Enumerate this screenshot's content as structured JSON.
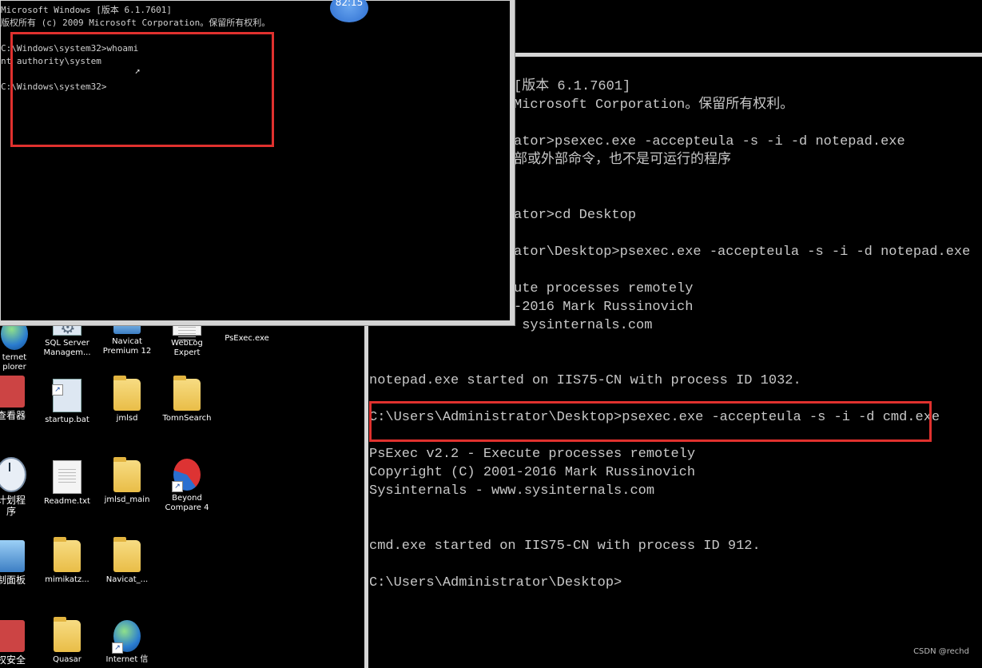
{
  "desktop": {
    "icons": [
      {
        "label": "ternet\nplorer",
        "icon": "internet-explorer-icon"
      },
      {
        "label": "SQL Server\nManagem...",
        "icon": "sql-server-icon"
      },
      {
        "label": "Navicat\nPremium 12",
        "icon": "navicat-icon"
      },
      {
        "label": "WebLog\nExpert",
        "icon": "weblog-icon"
      },
      {
        "label": "PsExec.exe",
        "icon": "exe-icon"
      },
      {
        "label": "查看器",
        "icon": "viewer-icon"
      },
      {
        "label": "startup.bat",
        "icon": "bat-file-icon"
      },
      {
        "label": "jmlsd",
        "icon": "folder-icon"
      },
      {
        "label": "TomnSearch",
        "icon": "folder-icon"
      },
      {
        "label": "计划程\n序",
        "icon": "task-scheduler-icon"
      },
      {
        "label": "Readme.txt",
        "icon": "text-file-icon"
      },
      {
        "label": "jmlsd_main",
        "icon": "folder-icon"
      },
      {
        "label": "Beyond\nCompare 4",
        "icon": "beyond-compare-icon"
      },
      {
        "label": "制面板",
        "icon": "control-panel-icon"
      },
      {
        "label": "mimikatz...",
        "icon": "folder-icon"
      },
      {
        "label": "Navicat_...",
        "icon": "folder-icon"
      },
      {
        "label": "权安全",
        "icon": "firewall-icon"
      },
      {
        "label": "Quasar",
        "icon": "folder-icon"
      },
      {
        "label": "Internet 信",
        "icon": "iis-manager-icon"
      }
    ]
  },
  "cmd_left": {
    "clock": "82:15",
    "lines": [
      "Microsoft Windows [版本 6.1.7601]",
      "版权所有 (c) 2009 Microsoft Corporation。保留所有权利。",
      "",
      "C:\\Windows\\system32>whoami",
      "nt authority\\system",
      "",
      "C:\\Windows\\system32>"
    ]
  },
  "console_right": {
    "lines": [
      "[版本 6.1.7601]",
      "Microsoft Corporation。保留所有权利。",
      "",
      "ator>psexec.exe -accepteula -s -i -d notepad.exe",
      "部或外部命令，也不是可运行的程序",
      "",
      "",
      "ator>cd Desktop",
      "",
      "ator\\Desktop>psexec.exe -accepteula -s -i -d notepad.exe",
      "",
      "ute processes remotely",
      "-2016 Mark Russinovich",
      " sysinternals.com",
      "",
      "notepad.exe started on IIS75-CN with process ID 1032.",
      "",
      "C:\\Users\\Administrator\\Desktop>psexec.exe -accepteula -s -i -d cmd.exe",
      "",
      "PsExec v2.2 - Execute processes remotely",
      "Copyright (C) 2001-2016 Mark Russinovich",
      "Sysinternals - www.sysinternals.com",
      "",
      "",
      "cmd.exe started on IIS75-CN with process ID 912.",
      "",
      "C:\\Users\\Administrator\\Desktop>"
    ]
  },
  "watermark": "CSDN @rechd",
  "colors": {
    "highlight": "#e0312e",
    "console_text": "#c8c8c8"
  }
}
